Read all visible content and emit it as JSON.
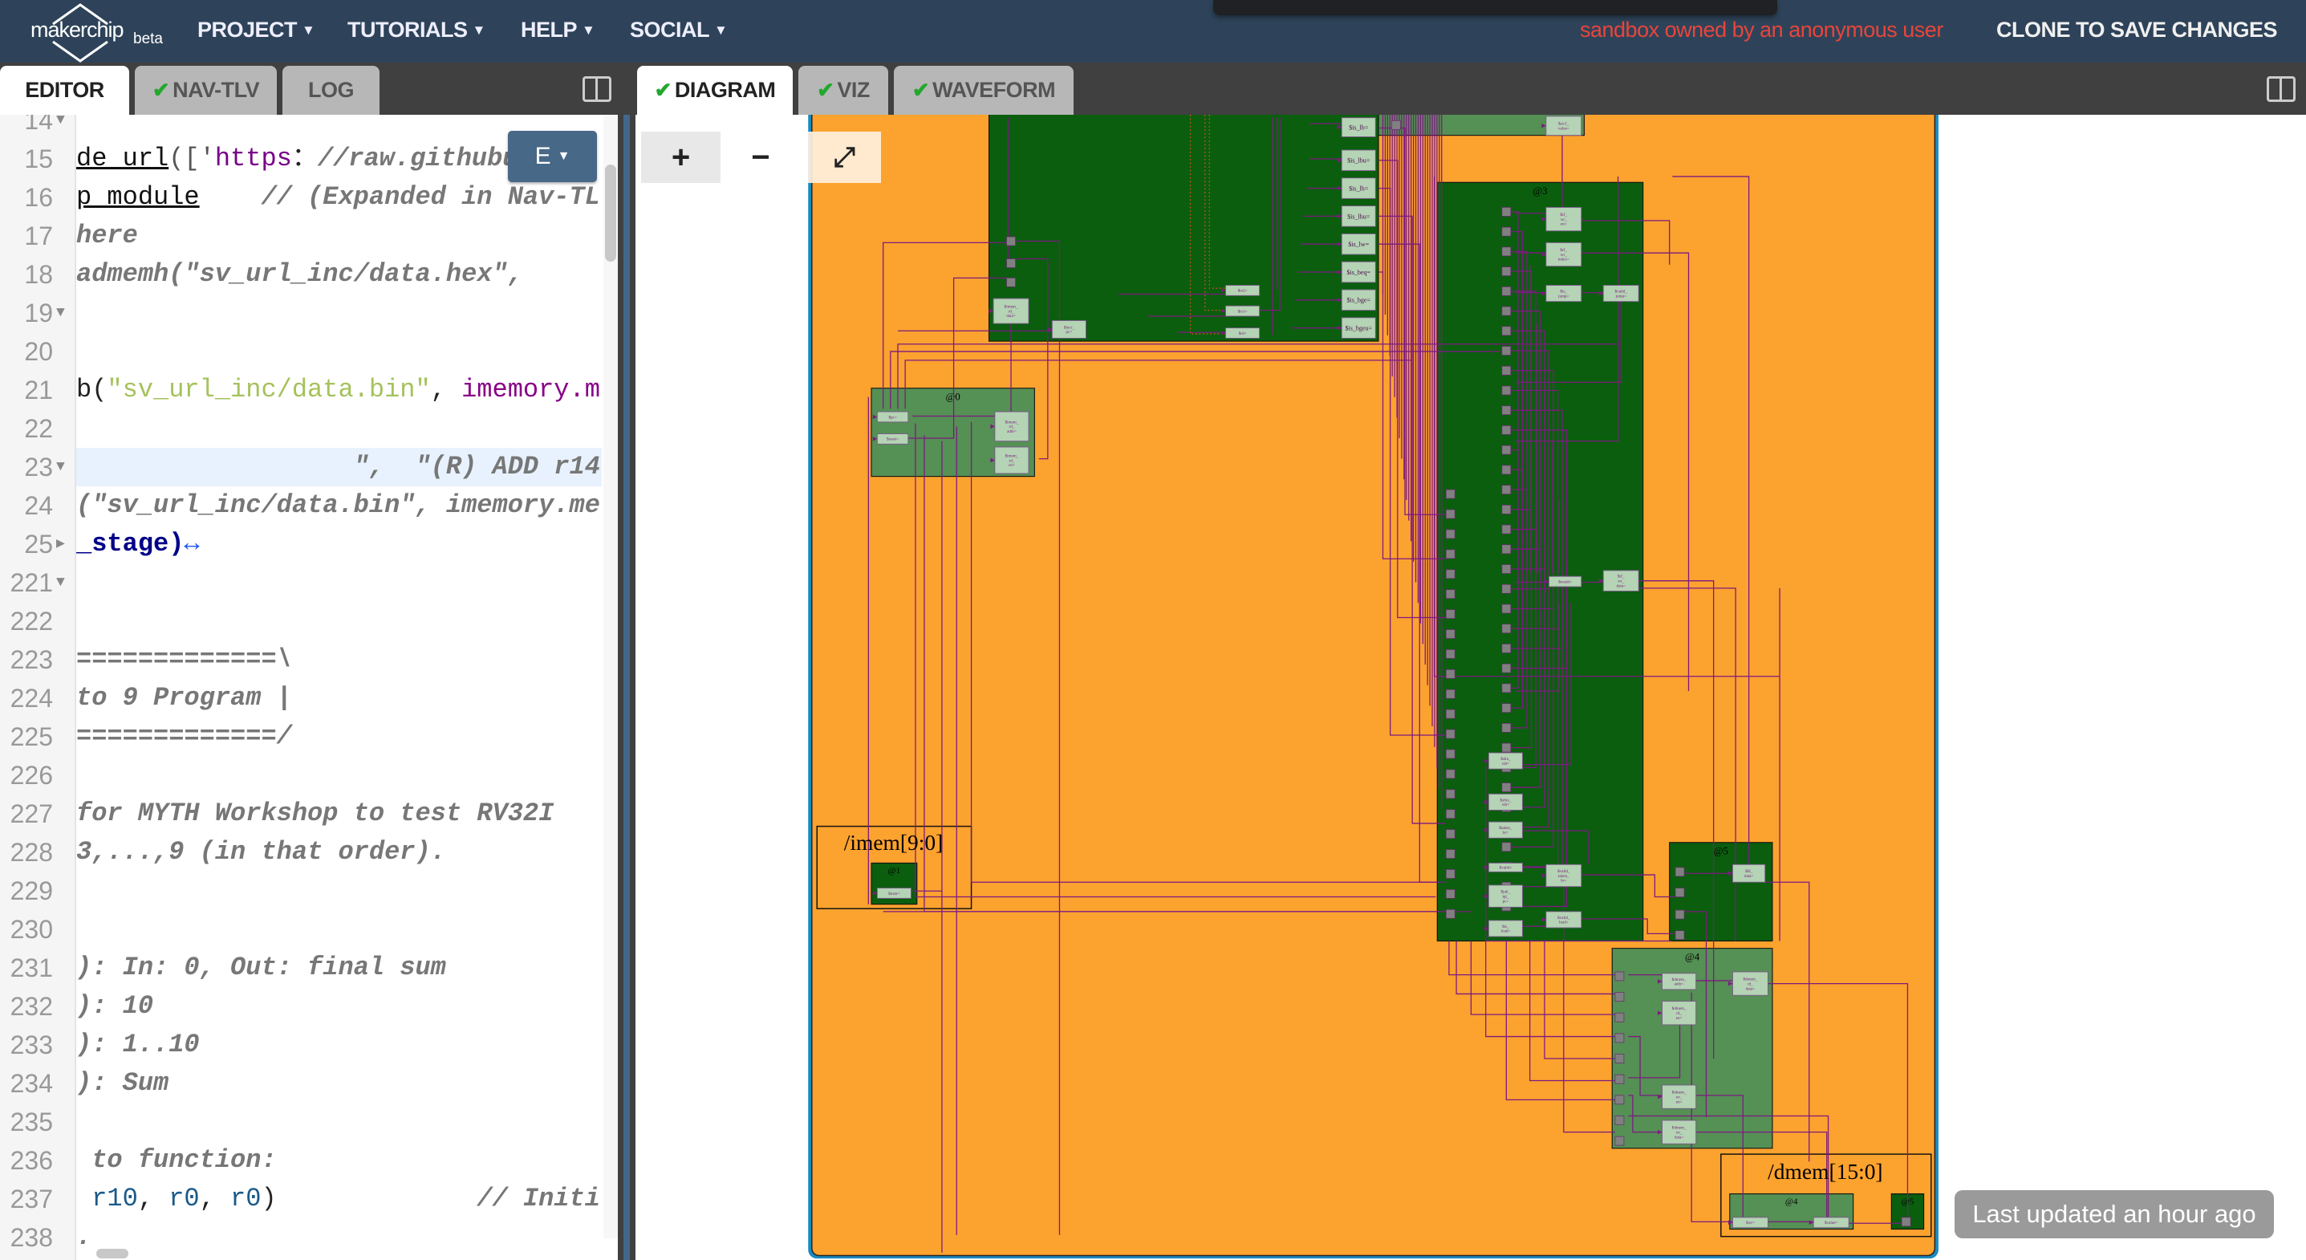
{
  "header": {
    "logo_text": "makerchip",
    "logo_badge": "beta",
    "menus": [
      {
        "label": "PROJECT"
      },
      {
        "label": "TUTORIALS"
      },
      {
        "label": "HELP"
      },
      {
        "label": "SOCIAL"
      }
    ],
    "owner_notice": "sandbox owned by an anonymous user",
    "clone_label": "CLONE TO SAVE CHANGES",
    "owner_color": "#e8453c"
  },
  "left_tabs": [
    {
      "label": "EDITOR",
      "active": true,
      "check": false
    },
    {
      "label": "NAV-TLV",
      "active": false,
      "check": true
    },
    {
      "label": "LOG",
      "active": false,
      "check": false
    }
  ],
  "right_tabs": [
    {
      "label": "DIAGRAM",
      "active": true,
      "check": true
    },
    {
      "label": "VIZ",
      "active": false,
      "check": true
    },
    {
      "label": "WAVEFORM",
      "active": false,
      "check": true
    }
  ],
  "check_glyph": "✔",
  "editor": {
    "mode_button": "E",
    "lines": [
      {
        "n": "14",
        "fold": "▼",
        "segs": []
      },
      {
        "n": "15",
        "fold": "",
        "segs": [
          [
            "und",
            "de_url"
          ],
          [
            "pun",
            "(['"
          ],
          [
            "str",
            "https"
          ],
          [
            "",
            "："
          ],
          [
            "cmt",
            "//raw.githubu"
          ]
        ]
      },
      {
        "n": "16",
        "fold": "",
        "segs": [
          [
            "und",
            "p_module"
          ],
          [
            "cmt",
            "    // (Expanded in Nav-TLV"
          ]
        ]
      },
      {
        "n": "17",
        "fold": "",
        "segs": [
          [
            "cmt",
            "here"
          ]
        ]
      },
      {
        "n": "18",
        "fold": "",
        "segs": [
          [
            "cmt",
            "admemh(\"sv_url_inc/data.hex\","
          ]
        ]
      },
      {
        "n": "19",
        "fold": "▼",
        "segs": []
      },
      {
        "n": "20",
        "fold": "",
        "segs": []
      },
      {
        "n": "21",
        "fold": "",
        "segs": [
          [
            "",
            "b("
          ],
          [
            "grn",
            "\"sv_url_inc/data.bin\""
          ],
          [
            "",
            ", "
          ],
          [
            "var",
            "imemory.m"
          ]
        ]
      },
      {
        "n": "22",
        "fold": "",
        "segs": []
      },
      {
        "n": "23",
        "fold": "▼",
        "hl": true,
        "segs": [
          [
            "cmt",
            "                  \",  \"(R) ADD r14"
          ]
        ]
      },
      {
        "n": "24",
        "fold": "",
        "segs": [
          [
            "cmt",
            "(\"sv_url_inc/data.bin\", imemory.me"
          ]
        ]
      },
      {
        "n": "25",
        "fold": "▶",
        "segs": [
          [
            "blu",
            "_stage)"
          ],
          [
            "arr",
            "↔"
          ]
        ]
      },
      {
        "n": "221",
        "fold": "▼",
        "segs": []
      },
      {
        "n": "222",
        "fold": "",
        "segs": []
      },
      {
        "n": "223",
        "fold": "",
        "segs": [
          [
            "cmt",
            "=============\\"
          ]
        ]
      },
      {
        "n": "224",
        "fold": "",
        "segs": [
          [
            "cmt",
            "to 9 Program |"
          ]
        ]
      },
      {
        "n": "225",
        "fold": "",
        "segs": [
          [
            "cmt",
            "=============/"
          ]
        ]
      },
      {
        "n": "226",
        "fold": "",
        "segs": []
      },
      {
        "n": "227",
        "fold": "",
        "segs": [
          [
            "cmt",
            "for MYTH Workshop to test RV32I"
          ]
        ]
      },
      {
        "n": "228",
        "fold": "",
        "segs": [
          [
            "cmt",
            "3,...,9 (in that order)."
          ]
        ]
      },
      {
        "n": "229",
        "fold": "",
        "segs": []
      },
      {
        "n": "230",
        "fold": "",
        "segs": []
      },
      {
        "n": "231",
        "fold": "",
        "segs": [
          [
            "cmt",
            "): In: 0, Out: final sum"
          ]
        ]
      },
      {
        "n": "232",
        "fold": "",
        "segs": [
          [
            "cmt",
            "): 10"
          ]
        ]
      },
      {
        "n": "233",
        "fold": "",
        "segs": [
          [
            "cmt",
            "): 1..10"
          ]
        ]
      },
      {
        "n": "234",
        "fold": "",
        "segs": [
          [
            "cmt",
            "): Sum"
          ]
        ]
      },
      {
        "n": "235",
        "fold": "",
        "segs": []
      },
      {
        "n": "236",
        "fold": "",
        "segs": [
          [
            "cmt",
            " to function:"
          ]
        ]
      },
      {
        "n": "237",
        "fold": "",
        "segs": [
          [
            "reg",
            " r10"
          ],
          [
            "",
            ", "
          ],
          [
            "reg",
            "r0"
          ],
          [
            "",
            ", "
          ],
          [
            "reg",
            "r0"
          ],
          [
            "",
            ")"
          ],
          [
            "cmt",
            "             // Initi"
          ]
        ]
      },
      {
        "n": "238",
        "fold": "",
        "segs": [
          [
            "cmt",
            "."
          ]
        ]
      }
    ]
  },
  "diagram": {
    "zoom_in": "+",
    "zoom_out": "−",
    "fit_icon": "⤢",
    "scopes": [
      "/imem[9:0]",
      "/dmem[15:0]"
    ],
    "stages": [
      "@0",
      "@1",
      "@3",
      "@5",
      "@4",
      "@4",
      "@5"
    ],
    "signals": [
      "$src1_value=",
      "$is_lb=",
      "$is_lbu=",
      "$is_lh=",
      "$is_lhu=",
      "$is_lw=",
      "$is_beq=",
      "$is_bge=",
      "$is_bgeu=",
      "$rs2=",
      "$rs1=",
      "$rd=",
      "$imem_rd_data=",
      "$incr_pc=",
      "$pc=",
      "$reset=",
      "$imem_rd_addr=",
      "$imem_rd_en=",
      "$rf_wr_en=",
      "$rf_wr_index=",
      "$is_jump=",
      "$valid_jump=",
      "$result=",
      "$rf_wr_data=",
      "$sltu_rslt=",
      "$sltiu_rslt=",
      "$taken_br=",
      "$valid=",
      "$jalr_tgt_pc=",
      "$is_load=",
      "$valid_taken_br=",
      "$valid_load=",
      "$ld_data=",
      "$dmem_addr=",
      "$dmem_rd_data=",
      "$dmem_rd_en=",
      "$dmem_wr_en=",
      "$dmem_wr_data=",
      "$instr=",
      "$wr=",
      "$value="
    ],
    "colors": {
      "background": "#fca22e",
      "stage_dark": "#0a5e0e",
      "stage_light": "#559055",
      "wire": "#7d1a80",
      "signal_box": "#b5d3b5"
    }
  },
  "status": {
    "last_updated": "Last updated an hour ago"
  }
}
